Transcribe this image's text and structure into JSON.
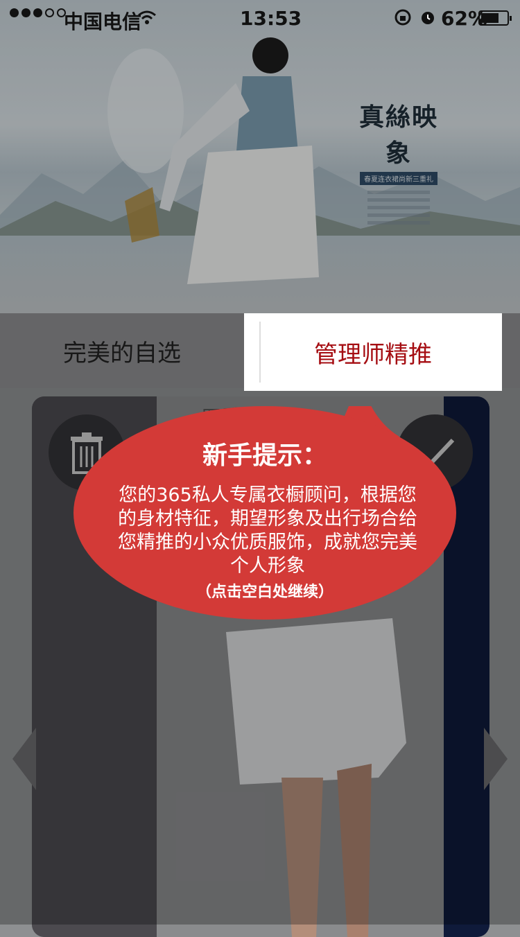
{
  "status_bar": {
    "carrier": "中国电信",
    "time": "13:53",
    "battery": "62%"
  },
  "banner": {
    "logo_text": "真絲映象",
    "logo_tagline": "春夏连衣裙尚新三重礼"
  },
  "tabs": [
    {
      "label": "完美的自选",
      "active": false
    },
    {
      "label": "管理师精推",
      "active": true
    }
  ],
  "card": {
    "label": "四季推荐"
  },
  "guide": {
    "title": "新手提示：",
    "body": "您的365私人专属衣橱顾问，根据您的身材特征，期望形象及出行场合给您精推的小众优质服饰，成就您完美个人形象",
    "hint": "（点击空白处继续）"
  },
  "icons": {
    "delete": "trash-icon",
    "confirm": "check-icon",
    "prev": "chevron-left-icon",
    "next": "chevron-right-icon"
  },
  "colors": {
    "accent_red": "#a50d12",
    "bubble_red": "#d33a37"
  }
}
